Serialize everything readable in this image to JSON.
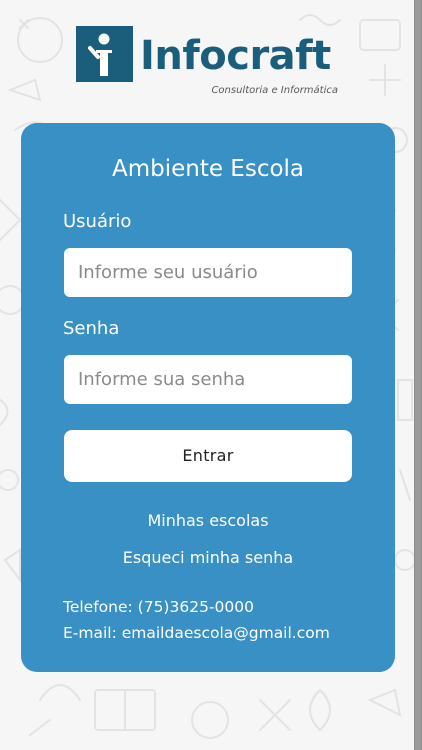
{
  "brand": {
    "name": "Infocraft",
    "tagline": "Consultoria e Informática",
    "color": "#1b5e7c"
  },
  "card": {
    "title": "Ambiente Escola",
    "color": "#3990c5"
  },
  "form": {
    "user_label": "Usuário",
    "user_placeholder": "Informe seu usuário",
    "password_label": "Senha",
    "password_placeholder": "Informe sua senha",
    "submit_label": "Entrar"
  },
  "links": {
    "my_schools": "Minhas escolas",
    "forgot_password": "Esqueci minha senha"
  },
  "contact": {
    "phone": "Telefone: (75)3625-0000",
    "email": "E-mail: emaildaescola@gmail.com"
  },
  "icons": {
    "logo": "person-in-square-icon"
  }
}
